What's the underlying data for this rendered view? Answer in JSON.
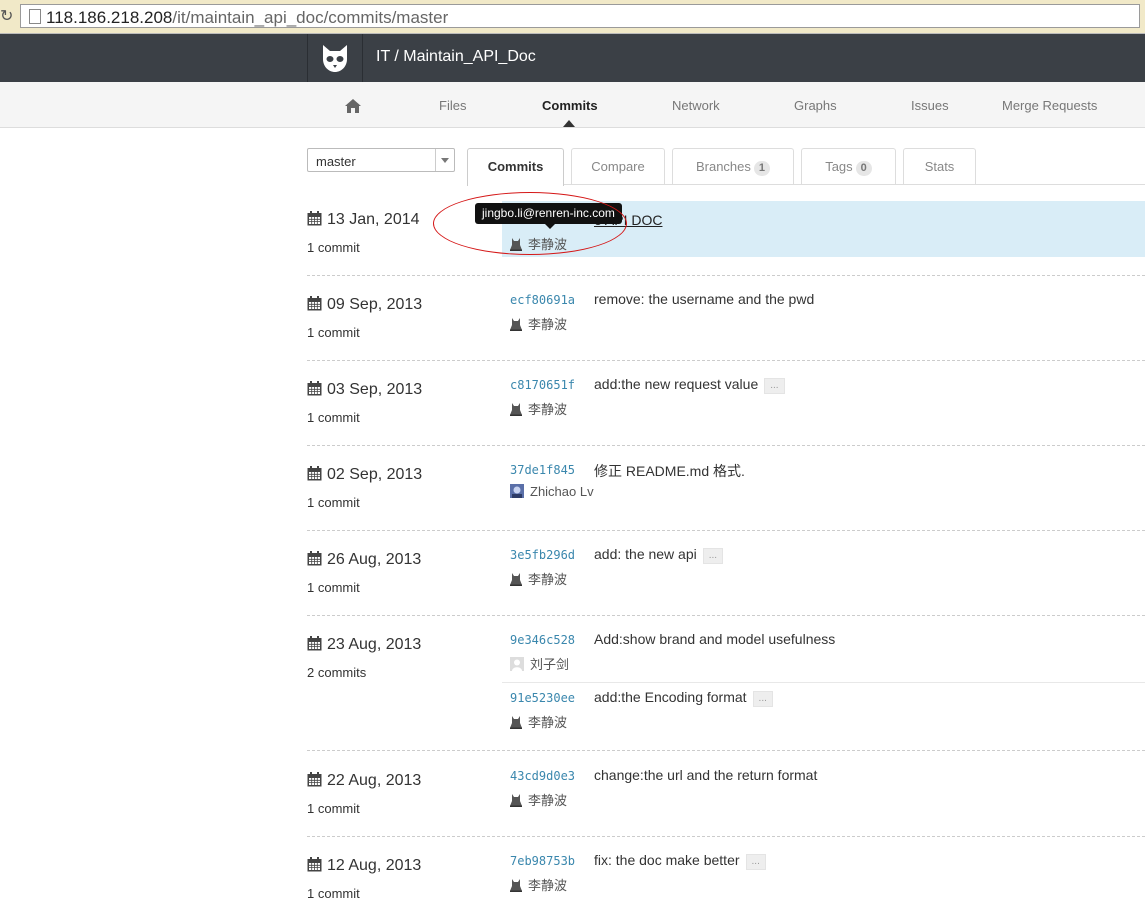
{
  "browser": {
    "url_host": "118.186.218.208",
    "url_path": "/it/maintain_api_doc/commits/master"
  },
  "header": {
    "project_title": "IT / Maintain_API_Doc"
  },
  "nav": {
    "items": [
      "Files",
      "Commits",
      "Network",
      "Graphs",
      "Issues",
      "Merge Requests"
    ],
    "active": "Commits"
  },
  "branch_select": {
    "value": "master"
  },
  "tabs": [
    {
      "label": "Commits",
      "badge": null,
      "active": true
    },
    {
      "label": "Compare",
      "badge": null
    },
    {
      "label": "Branches",
      "badge": "1"
    },
    {
      "label": "Tags",
      "badge": "0"
    },
    {
      "label": "Stats",
      "badge": null
    }
  ],
  "tooltip": {
    "text": "jingbo.li@renren-inc.com"
  },
  "more_label": "...",
  "groups": [
    {
      "date": "13 Jan, 2014",
      "count": "1 commit",
      "commits": [
        {
          "sha": "",
          "message": "e API DOC",
          "author": "李静波",
          "avatar": "user-silhouette",
          "highlighted": true
        }
      ]
    },
    {
      "date": "09 Sep, 2013",
      "count": "1 commit",
      "commits": [
        {
          "sha": "ecf80691a",
          "message": "remove: the username and the pwd",
          "author": "李静波",
          "avatar": "user-silhouette"
        }
      ]
    },
    {
      "date": "03 Sep, 2013",
      "count": "1 commit",
      "commits": [
        {
          "sha": "c8170651f",
          "message": "add:the new request value",
          "author": "李静波",
          "avatar": "user-silhouette",
          "more": true
        }
      ]
    },
    {
      "date": "02 Sep, 2013",
      "count": "1 commit",
      "commits": [
        {
          "sha": "37de1f845",
          "message": "修正 README.md 格式.",
          "author": "Zhichao Lv",
          "avatar": "photo"
        }
      ]
    },
    {
      "date": "26 Aug, 2013",
      "count": "1 commit",
      "commits": [
        {
          "sha": "3e5fb296d",
          "message": "add: the new api",
          "author": "李静波",
          "avatar": "user-silhouette",
          "more": true
        }
      ]
    },
    {
      "date": "23 Aug, 2013",
      "count": "2 commits",
      "commits": [
        {
          "sha": "9e346c528",
          "message": "Add:show brand and model usefulness",
          "author": "刘子剑",
          "avatar": "default"
        },
        {
          "sha": "91e5230ee",
          "message": "add:the Encoding format",
          "author": "李静波",
          "avatar": "user-silhouette",
          "more": true
        }
      ]
    },
    {
      "date": "22 Aug, 2013",
      "count": "1 commit",
      "commits": [
        {
          "sha": "43cd9d0e3",
          "message": "change:the url and the return format",
          "author": "李静波",
          "avatar": "user-silhouette"
        }
      ]
    },
    {
      "date": "12 Aug, 2013",
      "count": "1 commit",
      "commits": [
        {
          "sha": "7eb98753b",
          "message": "fix: the doc make better",
          "author": "李静波",
          "avatar": "user-silhouette",
          "more": true
        }
      ]
    }
  ],
  "colors": {
    "header_bg": "#3b4046",
    "highlight_row": "#d9edf7",
    "sha_link": "#3a87ad",
    "annotation": "#d51818"
  }
}
